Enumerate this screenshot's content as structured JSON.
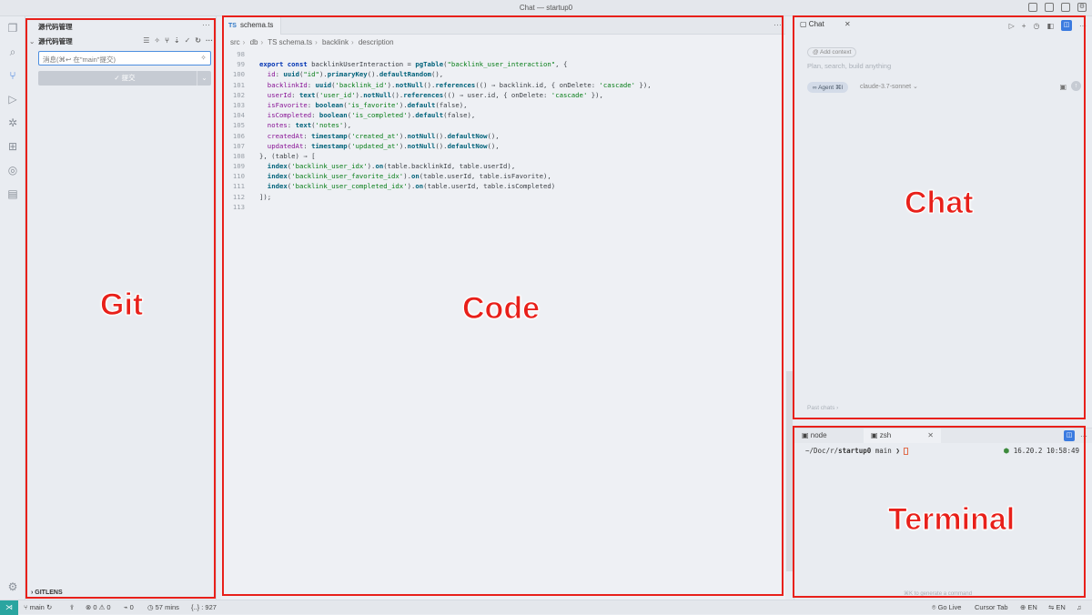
{
  "window": {
    "title": "Chat — startup0"
  },
  "sidebar": {
    "title": "源代码管理",
    "more": "···",
    "scm_header": "源代码管理",
    "commit_placeholder": "消息(⌘↩ 在\"main\"提交)",
    "commit_button": "✓ 提交",
    "gitlens": "GITLENS"
  },
  "editor": {
    "tab": {
      "badge": "TS",
      "label": "schema.ts"
    },
    "breadcrumb": [
      "src",
      "db",
      "TS schema.ts",
      "backlink",
      "description"
    ],
    "lines": [
      {
        "n": "98",
        "code": ""
      },
      {
        "n": "99",
        "code": "export const backlinkUserInteraction = pgTable(\"backlink_user_interaction\", {"
      },
      {
        "n": "100",
        "code": "  id: uuid(\"id\").primaryKey().defaultRandom(),"
      },
      {
        "n": "101",
        "code": "  backlinkId: uuid('backlink_id').notNull().references(() ⇒ backlink.id, { onDelete: 'cascade' }),"
      },
      {
        "n": "102",
        "code": "  userId: text('user_id').notNull().references(() ⇒ user.id, { onDelete: 'cascade' }),"
      },
      {
        "n": "103",
        "code": "  isFavorite: boolean('is_favorite').default(false),"
      },
      {
        "n": "104",
        "code": "  isCompleted: boolean('is_completed').default(false),"
      },
      {
        "n": "105",
        "code": "  notes: text('notes'),"
      },
      {
        "n": "106",
        "code": "  createdAt: timestamp('created_at').notNull().defaultNow(),"
      },
      {
        "n": "107",
        "code": "  updatedAt: timestamp('updated_at').notNull().defaultNow(),"
      },
      {
        "n": "108",
        "code": "}, (table) ⇒ ["
      },
      {
        "n": "109",
        "code": "  index('backlink_user_idx').on(table.backlinkId, table.userId),"
      },
      {
        "n": "110",
        "code": "  index('backlink_user_favorite_idx').on(table.userId, table.isFavorite),"
      },
      {
        "n": "111",
        "code": "  index('backlink_user_completed_idx').on(table.userId, table.isCompleted)"
      },
      {
        "n": "112",
        "code": "]);"
      },
      {
        "n": "113",
        "code": ""
      }
    ]
  },
  "chat": {
    "tab": "Chat",
    "add_context": "Add context",
    "placeholder": "Plan, search, build anything",
    "agent": "∞ Agent ⌘I",
    "model": "claude-3.7-sonnet",
    "past_chats": "Past chats  ›"
  },
  "terminal": {
    "tabs": [
      "node",
      "zsh"
    ],
    "prompt_path": "~/Doc/r/",
    "prompt_dir": "startup0",
    "prompt_branch": " main ❯ ",
    "node_version": "16.20.2",
    "time": "10:58:49",
    "hint": "⌘K to generate a command"
  },
  "overlay_labels": {
    "git": "Git",
    "code": "Code",
    "chat": "Chat",
    "terminal": "Terminal"
  },
  "statusbar": {
    "branch": "main",
    "errors": "⊗ 0 ⚠ 0",
    "ports": "0",
    "time": "57 mins",
    "braces": "{..} : 927",
    "golive": "Go Live",
    "cursortab": "Cursor Tab",
    "lang1": "EN",
    "lang2": "EN"
  }
}
